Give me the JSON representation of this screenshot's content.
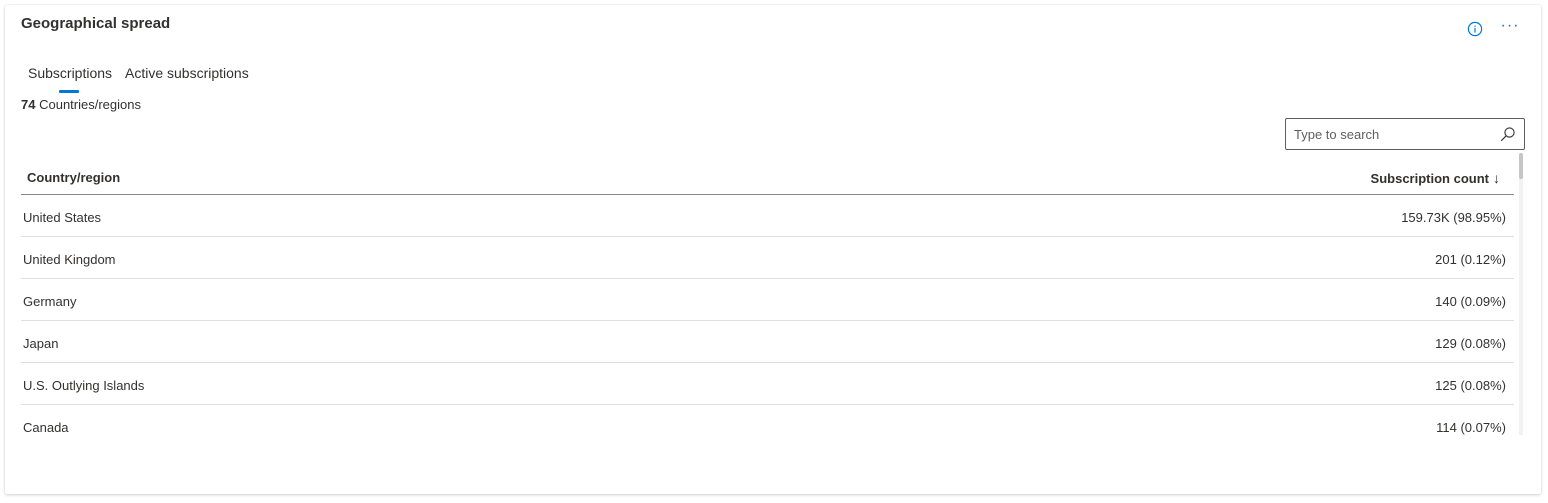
{
  "card": {
    "title": "Geographical spread",
    "info_icon": "info-icon",
    "more_icon": "more-icon",
    "more_glyph": "···"
  },
  "tabs": [
    {
      "label": "Subscriptions",
      "selected": true
    },
    {
      "label": "Active subscriptions",
      "selected": false
    }
  ],
  "summary": {
    "count": "74",
    "label": "Countries/regions"
  },
  "search": {
    "placeholder": "Type to search",
    "value": ""
  },
  "table": {
    "columns": {
      "country": "Country/region",
      "count": "Subscription count",
      "sort_glyph": "↓"
    },
    "rows": [
      {
        "country": "United States",
        "count": "159.73K (98.95%)"
      },
      {
        "country": "United Kingdom",
        "count": "201 (0.12%)"
      },
      {
        "country": "Germany",
        "count": "140 (0.09%)"
      },
      {
        "country": "Japan",
        "count": "129 (0.08%)"
      },
      {
        "country": "U.S. Outlying Islands",
        "count": "125 (0.08%)"
      },
      {
        "country": "Canada",
        "count": "114 (0.07%)"
      }
    ]
  },
  "colors": {
    "accent": "#0078d4",
    "text": "#323130",
    "border": "#8a8886",
    "row_divider": "#e1dfdd"
  }
}
